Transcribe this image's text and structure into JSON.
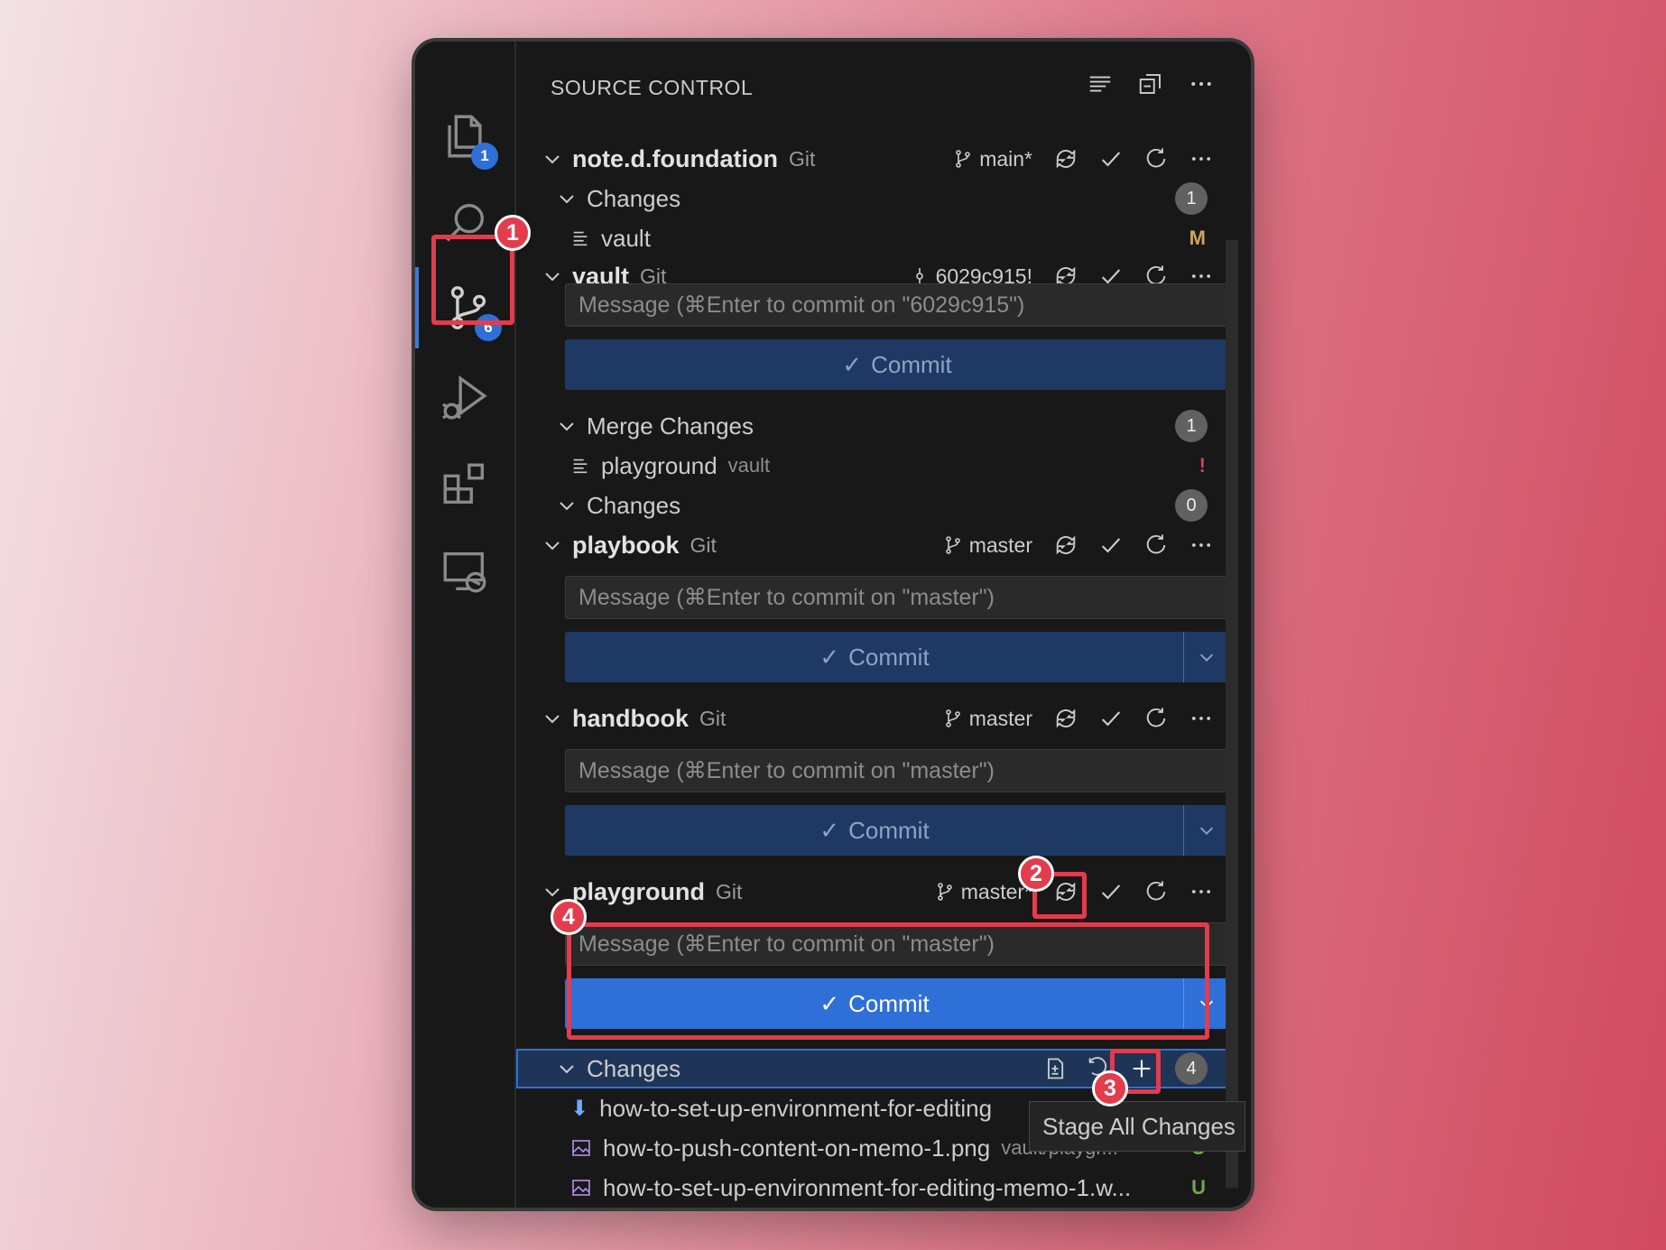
{
  "header": {
    "title": "SOURCE CONTROL"
  },
  "activity": {
    "explorer_badge": "1",
    "scm_badge": "6"
  },
  "repos": [
    {
      "name": "note.d.foundation",
      "kind": "Git",
      "branch": "main*"
    },
    {
      "name": "vault",
      "kind": "Git",
      "branch": "6029c915!",
      "message_placeholder": "Message (⌘Enter to commit on \"6029c915\")",
      "commit_label": "Commit"
    },
    {
      "name": "playbook",
      "kind": "Git",
      "branch": "master",
      "message_placeholder": "Message (⌘Enter to commit on \"master\")",
      "commit_label": "Commit"
    },
    {
      "name": "handbook",
      "kind": "Git",
      "branch": "master",
      "message_placeholder": "Message (⌘Enter to commit on \"master\")",
      "commit_label": "Commit"
    },
    {
      "name": "playground",
      "kind": "Git",
      "branch": "master*",
      "message_placeholder": "Message (⌘Enter to commit on \"master\")",
      "commit_label": "Commit"
    }
  ],
  "groups": {
    "foundation_changes": {
      "label": "Changes",
      "count": "1"
    },
    "vault_merge": {
      "label": "Merge Changes",
      "count": "1"
    },
    "vault_changes": {
      "label": "Changes",
      "count": "0"
    },
    "playground_changes": {
      "label": "Changes",
      "count": "4"
    }
  },
  "files": {
    "vault_file": {
      "name": "vault",
      "status": "M"
    },
    "playground_file": {
      "name": "playground",
      "desc": "vault",
      "status": "!"
    },
    "pg1": {
      "name": "how-to-set-up-environment-for-editing"
    },
    "pg2": {
      "name": "how-to-push-content-on-memo-1.png",
      "desc": "vault/playgr...",
      "status": "U"
    },
    "pg3": {
      "name": "how-to-set-up-environment-for-editing-memo-1.w...",
      "status": "U"
    }
  },
  "tooltip": "Stage All Changes",
  "markers": [
    "1",
    "2",
    "3",
    "4"
  ],
  "colors": {
    "accent": "#2f6fd8",
    "highlight": "#e23c4d",
    "modified": "#c9a75f",
    "untracked": "#6aa84f",
    "conflict": "#e23c4d"
  }
}
